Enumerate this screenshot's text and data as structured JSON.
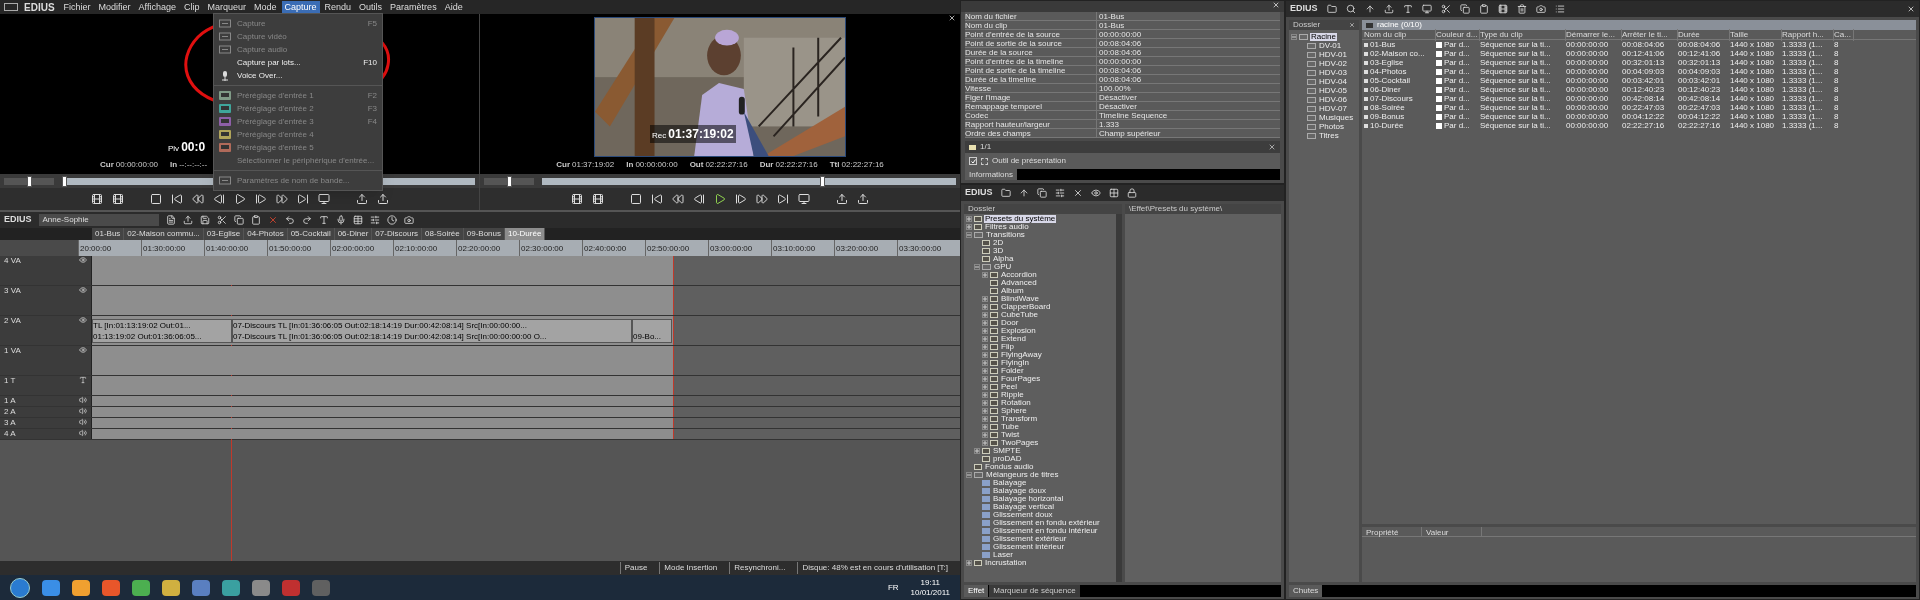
{
  "menu_bar": {
    "app": "EDIUS",
    "items": [
      {
        "label": "Fichier",
        "selected": false
      },
      {
        "label": "Modifier",
        "selected": false
      },
      {
        "label": "Affichage",
        "selected": false
      },
      {
        "label": "Clip",
        "selected": false
      },
      {
        "label": "Marqueur",
        "selected": false
      },
      {
        "label": "Mode",
        "selected": false
      },
      {
        "label": "Capture",
        "selected": true
      },
      {
        "label": "Rendu",
        "selected": false
      },
      {
        "label": "Outils",
        "selected": false
      },
      {
        "label": "Paramètres",
        "selected": false
      },
      {
        "label": "Aide",
        "selected": false
      }
    ]
  },
  "capture_menu": [
    {
      "kind": "capture",
      "label": "Capture",
      "shortcut": "F5",
      "disabled": true
    },
    {
      "kind": "video",
      "label": "Capture vidéo",
      "disabled": true
    },
    {
      "kind": "audio",
      "label": "Capture audio",
      "disabled": true
    },
    {
      "kind": "plain",
      "label": "Capture par lots...",
      "shortcut": "F10",
      "disabled": false
    },
    {
      "kind": "mic",
      "label": "Voice Over...",
      "disabled": false
    },
    {
      "kind": "separator"
    },
    {
      "kind": "preset",
      "label": "Préréglage d'entrée 1",
      "shortcut": "F2",
      "disabled": true,
      "color": "#7f9a86"
    },
    {
      "kind": "preset",
      "label": "Préréglage d'entrée 2",
      "shortcut": "F3",
      "disabled": true,
      "color": "#3fa59a"
    },
    {
      "kind": "preset",
      "label": "Préréglage d'entrée 3",
      "shortcut": "F4",
      "disabled": true,
      "color": "#8e5fa8"
    },
    {
      "kind": "preset",
      "label": "Préréglage d'entrée 4",
      "disabled": true,
      "color": "#b0a45a"
    },
    {
      "kind": "preset",
      "label": "Préréglage d'entrée 5",
      "disabled": true,
      "color": "#b06a5a"
    },
    {
      "kind": "plain",
      "label": "Sélectionner le périphérique d'entrée...",
      "disabled": true
    },
    {
      "kind": "separator"
    },
    {
      "kind": "tape",
      "label": "Paramètres de nom de bande...",
      "disabled": true
    }
  ],
  "recorder": {
    "zoom": {
      "level": 0.5
    },
    "position": {
      "level": 0
    },
    "overlay_label": "Plv",
    "overlay_timecode": "00:0",
    "timecodes": [
      {
        "label": "Cur",
        "value": "00:00:00:00"
      },
      {
        "label": "In",
        "value": "--:--:--:--"
      }
    ]
  },
  "player": {
    "zoom": {
      "level": 0.5
    },
    "overlay_label": "Rec",
    "overlay_timecode": "01:37:19:02",
    "timecodes": [
      {
        "label": "Cur",
        "value": "01:37:19:02"
      },
      {
        "label": "In",
        "value": "00:00:00:00"
      },
      {
        "label": "Out",
        "value": "02:22:27:16"
      },
      {
        "label": "Dur",
        "value": "02:22:27:16"
      },
      {
        "label": "Ttl",
        "value": "02:22:27:16"
      }
    ],
    "level": 0.68
  },
  "timeline": {
    "app": "EDIUS",
    "project": "Anne-Sophie",
    "sequences": [
      {
        "label": "01-Bus",
        "selected": false
      },
      {
        "label": "02-Maison commu...",
        "selected": false
      },
      {
        "label": "03-Eglise",
        "selected": false
      },
      {
        "label": "04-Photos",
        "selected": false
      },
      {
        "label": "05-Cocktail",
        "selected": false
      },
      {
        "label": "06-Diner",
        "selected": false
      },
      {
        "label": "07-Discours",
        "selected": false
      },
      {
        "label": "08-Soirée",
        "selected": false
      },
      {
        "label": "09-Bonus",
        "selected": false
      },
      {
        "label": "10-Durée",
        "selected": true
      }
    ],
    "ruler": [
      "20:00:00",
      "01:30:00:00",
      "01:40:00:00",
      "01:50:00:00",
      "02:00:00:00",
      "02:10:00:00",
      "02:20:00:00",
      "02:30:00:00",
      "02:40:00:00",
      "02:50:00:00",
      "03:00:00:00",
      "03:10:00:00",
      "03:20:00:00",
      "03:30:00:00"
    ],
    "tracks": [
      {
        "name": "4 VA",
        "kind": "va"
      },
      {
        "name": "3 VA",
        "kind": "va"
      },
      {
        "name": "2 VA",
        "kind": "va",
        "clips": [
          {
            "top": "TL [In:01:13:19:02 Out:01...",
            "bottom": "01:13:19:02 Out:01:36:06:05..."
          },
          {
            "top": "07-Discours  TL [In:01:36:06:05 Out:02:18:14:19 Dur:00:42:08:14]  Src[In:00:00:00...",
            "bottom": "07-Discours  TL [In:01:36:06:05 Out:02:18:14:19 Dur:00:42:08:14]  Src[In:00:00:00:00 O..."
          },
          {
            "bottom": "09-Bo..."
          }
        ]
      },
      {
        "name": "1 VA",
        "kind": "va"
      },
      {
        "name": "1 T",
        "kind": "t"
      },
      {
        "name": "1 A",
        "kind": "a"
      },
      {
        "name": "2 A",
        "kind": "a"
      },
      {
        "name": "3 A",
        "kind": "a"
      },
      {
        "name": "4 A",
        "kind": "a"
      }
    ],
    "status": [
      "Pause",
      "Mode Insertion",
      "Resynchroni...",
      "Disque: 48% est en cours d'utilisation [T:]"
    ]
  },
  "info": {
    "rows": [
      [
        "Nom du fichier",
        "01-Bus"
      ],
      [
        "Nom du clip",
        "01-Bus"
      ],
      [
        "Point d'entrée de la source",
        "00:00:00:00"
      ],
      [
        "Point de sortie de la source",
        "00:08:04:06"
      ],
      [
        "Durée de la source",
        "00:08:04:06"
      ],
      [
        "Point d'entrée de la timeline",
        "00:00:00:00"
      ],
      [
        "Point de sortie de la timeline",
        "00:08:04:06"
      ],
      [
        "Durée de la timeline",
        "00:08:04:06"
      ],
      [
        "Vitesse",
        "100.00%"
      ],
      [
        "Figer l'image",
        "Désactiver"
      ],
      [
        "Remappage temporel",
        "Désactiver"
      ],
      [
        "Codec",
        "Timeline Sequence"
      ],
      [
        "Rapport hauteur/largeur",
        "1.333"
      ],
      [
        "Ordre des champs",
        "Champ supérieur"
      ]
    ],
    "layer_count": "1/1",
    "layers": [
      {
        "label": "Outil de présentation",
        "checked": true
      }
    ],
    "tab": "Informations"
  },
  "effects": {
    "app": "EDIUS",
    "folder_header": "Dossier",
    "path": "\\Effet\\Presets du système\\",
    "tree": [
      {
        "label": "Presets du système",
        "kind": "fx",
        "expanded": false,
        "selected": true
      },
      {
        "label": "Filtres audio",
        "kind": "fx",
        "expanded": false,
        "selected": false
      },
      {
        "label": "Transitions",
        "kind": "folder",
        "expanded": true,
        "selected": false,
        "children": [
          {
            "label": "2D",
            "kind": "fx",
            "selected": false
          },
          {
            "label": "3D",
            "kind": "fx",
            "selected": false
          },
          {
            "label": "Alpha",
            "kind": "fx",
            "selected": false
          },
          {
            "label": "GPU",
            "kind": "folder",
            "expanded": true,
            "selected": false,
            "children": [
              {
                "label": "Accordion",
                "kind": "fx",
                "expanded": false,
                "selected": false
              },
              {
                "label": "Advanced",
                "kind": "fx",
                "selected": false
              },
              {
                "label": "Album",
                "kind": "fx",
                "selected": false
              },
              {
                "label": "BlindWave",
                "kind": "fx",
                "expanded": false,
                "selected": false
              },
              {
                "label": "ClapperBoard",
                "kind": "fx",
                "expanded": false,
                "selected": false
              },
              {
                "label": "CubeTube",
                "kind": "fx",
                "expanded": false,
                "selected": false
              },
              {
                "label": "Door",
                "kind": "fx",
                "expanded": false,
                "selected": false
              },
              {
                "label": "Explosion",
                "kind": "fx",
                "expanded": false,
                "selected": false
              },
              {
                "label": "Extend",
                "kind": "fx",
                "expanded": false,
                "selected": false
              },
              {
                "label": "Flip",
                "kind": "fx",
                "expanded": false,
                "selected": false
              },
              {
                "label": "FlyingAway",
                "kind": "fx",
                "expanded": false,
                "selected": false
              },
              {
                "label": "FlyingIn",
                "kind": "fx",
                "expanded": false,
                "selected": false
              },
              {
                "label": "Folder",
                "kind": "fx",
                "expanded": false,
                "selected": false
              },
              {
                "label": "FourPages",
                "kind": "fx",
                "expanded": false,
                "selected": false
              },
              {
                "label": "Peel",
                "kind": "fx",
                "expanded": false,
                "selected": false
              },
              {
                "label": "Ripple",
                "kind": "fx",
                "expanded": false,
                "selected": false
              },
              {
                "label": "Rotation",
                "kind": "fx",
                "expanded": false,
                "selected": false
              },
              {
                "label": "Sphere",
                "kind": "fx",
                "expanded": false,
                "selected": false
              },
              {
                "label": "Transform",
                "kind": "fx",
                "expanded": false,
                "selected": false
              },
              {
                "label": "Tube",
                "kind": "fx",
                "expanded": false,
                "selected": false
              },
              {
                "label": "Twist",
                "kind": "fx",
                "expanded": false,
                "selected": false
              },
              {
                "label": "TwoPages",
                "kind": "fx",
                "expanded": false,
                "selected": false
              }
            ]
          },
          {
            "label": "SMPTE",
            "kind": "fx",
            "expanded": false,
            "selected": false
          },
          {
            "label": "proDAD",
            "kind": "fx",
            "selected": false
          }
        ]
      },
      {
        "label": "Fondus audio",
        "kind": "fx",
        "selected": false
      },
      {
        "label": "Mélangeurs de titres",
        "kind": "folder",
        "expanded": true,
        "selected": false,
        "children": [
          {
            "label": "Balayage",
            "kind": "title",
            "selected": false
          },
          {
            "label": "Balayage doux",
            "kind": "title",
            "selected": false
          },
          {
            "label": "Balayage horizontal",
            "kind": "title",
            "selected": false
          },
          {
            "label": "Balayage vertical",
            "kind": "title",
            "selected": false
          },
          {
            "label": "Glissement doux",
            "kind": "title",
            "selected": false
          },
          {
            "label": "Glissement en fondu extérieur",
            "kind": "title",
            "selected": false
          },
          {
            "label": "Glissement en fondu intérieur",
            "kind": "title",
            "selected": false
          },
          {
            "label": "Glissement extérieur",
            "kind": "title",
            "selected": false
          },
          {
            "label": "Glissement intérieur",
            "kind": "title",
            "selected": false
          },
          {
            "label": "Laser",
            "kind": "title",
            "selected": false
          }
        ]
      },
      {
        "label": "Incrustation",
        "kind": "fx",
        "expanded": false,
        "selected": false
      }
    ],
    "tabs": [
      {
        "label": "Effet",
        "selected": true
      },
      {
        "label": "Marqueur de séquence",
        "selected": false
      }
    ]
  },
  "bin": {
    "app": "EDIUS",
    "folder_header": "Dossier",
    "folders": [
      {
        "label": "Racine",
        "expanded": true,
        "selected": true,
        "children": [
          {
            "label": "DV-01",
            "selected": false
          },
          {
            "label": "HDV-01",
            "selected": false
          },
          {
            "label": "HDV-02",
            "selected": false
          },
          {
            "label": "HDV-03",
            "selected": false
          },
          {
            "label": "HDV-04",
            "selected": false
          },
          {
            "label": "HDV-05",
            "selected": false
          },
          {
            "label": "HDV-06",
            "selected": false
          },
          {
            "label": "HDV-07",
            "selected": false
          },
          {
            "label": "Musiques",
            "selected": false
          },
          {
            "label": "Photos",
            "selected": false
          },
          {
            "label": "Titres",
            "selected": false
          }
        ]
      }
    ],
    "list_title": "racine (0/10)",
    "columns": [
      "Nom du clip",
      "Couleur d...",
      "Type du clip",
      "Démarrer le...",
      "Arrêter le ti...",
      "Durée",
      "Taille",
      "Rapport h...",
      "Ca..."
    ],
    "rows": [
      [
        "01-Bus",
        "Par d...",
        "Séquence sur la ti...",
        "00:00:00:00",
        "00:08:04:06",
        "00:08:04:06",
        "1440 x 1080",
        "1.3333 (1...",
        "8"
      ],
      [
        "02-Maison co...",
        "Par d...",
        "Séquence sur la ti...",
        "00:00:00:00",
        "00:12:41:06",
        "00:12:41:06",
        "1440 x 1080",
        "1.3333 (1...",
        "8"
      ],
      [
        "03-Eglise",
        "Par d...",
        "Séquence sur la ti...",
        "00:00:00:00",
        "00:32:01:13",
        "00:32:01:13",
        "1440 x 1080",
        "1.3333 (1...",
        "8"
      ],
      [
        "04-Photos",
        "Par d...",
        "Séquence sur la ti...",
        "00:00:00:00",
        "00:04:09:03",
        "00:04:09:03",
        "1440 x 1080",
        "1.3333 (1...",
        "8"
      ],
      [
        "05-Cocktail",
        "Par d...",
        "Séquence sur la ti...",
        "00:00:00:00",
        "00:03:42:01",
        "00:03:42:01",
        "1440 x 1080",
        "1.3333 (1...",
        "8"
      ],
      [
        "06-Diner",
        "Par d...",
        "Séquence sur la ti...",
        "00:00:00:00",
        "00:12:40:23",
        "00:12:40:23",
        "1440 x 1080",
        "1.3333 (1...",
        "8"
      ],
      [
        "07-Discours",
        "Par d...",
        "Séquence sur la ti...",
        "00:00:00:00",
        "00:42:08:14",
        "00:42:08:14",
        "1440 x 1080",
        "1.3333 (1...",
        "8"
      ],
      [
        "08-Soirée",
        "Par d...",
        "Séquence sur la ti...",
        "00:00:00:00",
        "00:22:47:03",
        "00:22:47:03",
        "1440 x 1080",
        "1.3333 (1...",
        "8"
      ],
      [
        "09-Bonus",
        "Par d...",
        "Séquence sur la ti...",
        "00:00:00:00",
        "00:04:12:22",
        "00:04:12:22",
        "1440 x 1080",
        "1.3333 (1...",
        "8"
      ],
      [
        "10-Durée",
        "Par d...",
        "Séquence sur la ti...",
        "00:00:00:00",
        "02:22:27:16",
        "02:22:27:16",
        "1440 x 1080",
        "1.3333 (1...",
        "8"
      ]
    ],
    "property_columns": [
      "Propriété",
      "Valeur"
    ],
    "tab": "Chutes"
  },
  "taskbar": {
    "language": "FR",
    "time": "19:11",
    "date": "10/01/2011"
  }
}
